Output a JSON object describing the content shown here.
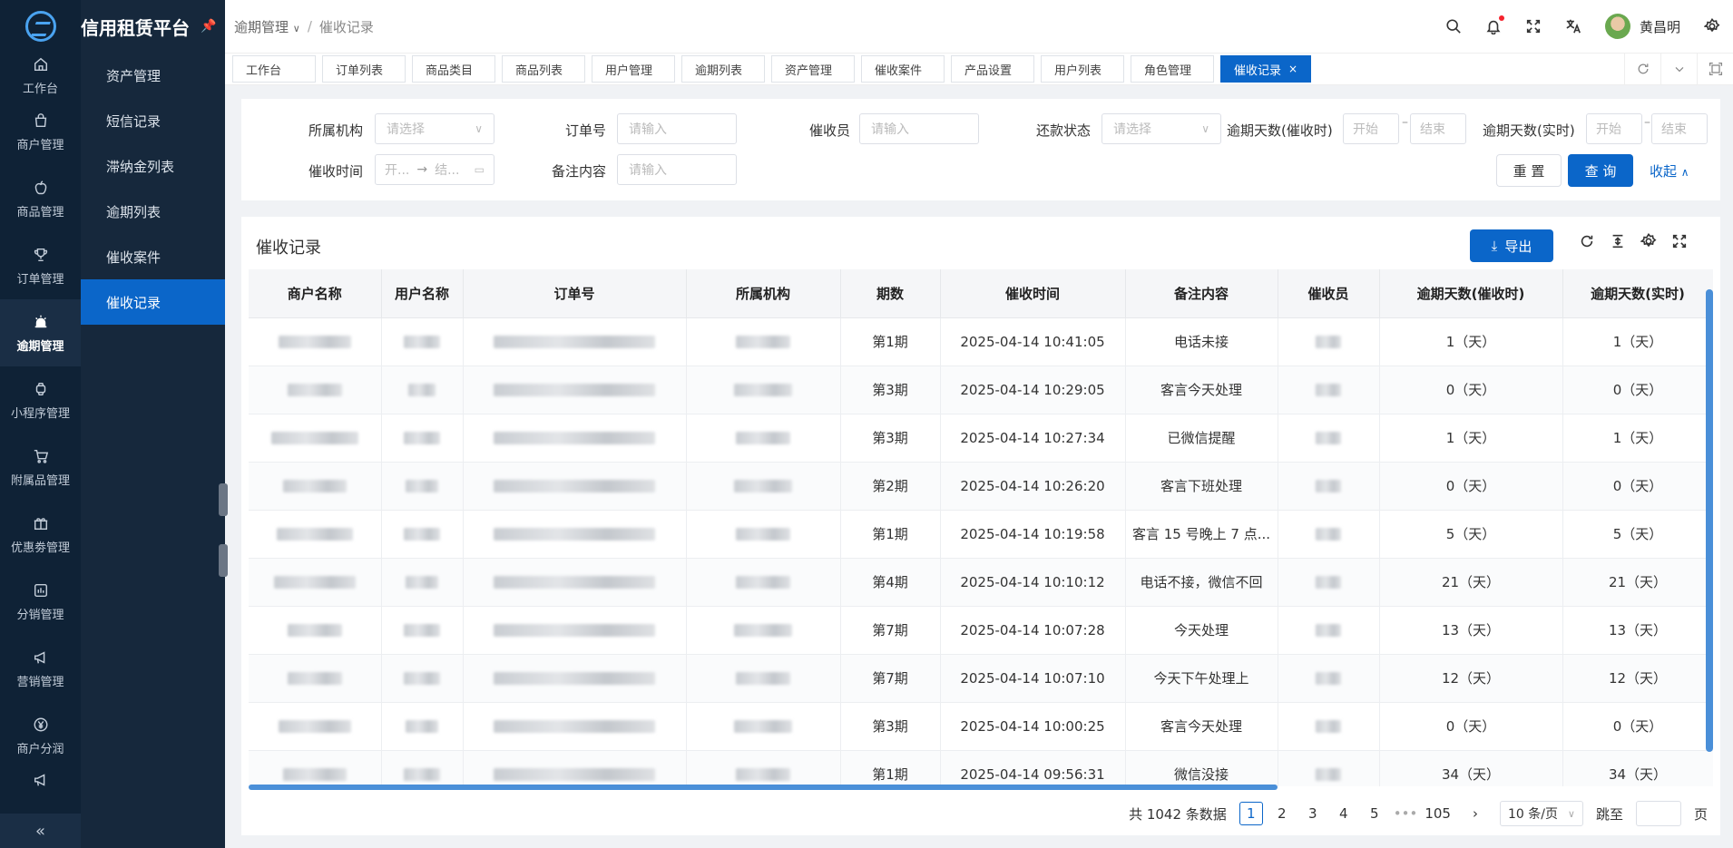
{
  "app": {
    "title": "信用租赁平台"
  },
  "rail": {
    "items": [
      {
        "label": "工作台",
        "icon": "home-icon"
      },
      {
        "label": "商户管理",
        "icon": "shop-icon"
      },
      {
        "label": "商品管理",
        "icon": "apple-icon"
      },
      {
        "label": "订单管理",
        "icon": "trophy-icon"
      },
      {
        "label": "逾期管理",
        "icon": "alarm-icon"
      },
      {
        "label": "小程序管理",
        "icon": "watch-icon"
      },
      {
        "label": "附属品管理",
        "icon": "cart-icon"
      },
      {
        "label": "优惠劵管理",
        "icon": "gift-icon"
      },
      {
        "label": "分销管理",
        "icon": "chart-icon"
      },
      {
        "label": "营销管理",
        "icon": "megaphone-icon"
      },
      {
        "label": "商户分润",
        "icon": "yen-icon"
      }
    ],
    "active_index": 4,
    "collapse_glyph": "«"
  },
  "submenu": {
    "items": [
      "资产管理",
      "短信记录",
      "滞纳金列表",
      "逾期列表",
      "催收案件",
      "催收记录"
    ],
    "active_index": 5
  },
  "breadcrumb": {
    "parent": "逾期管理",
    "separator": "/",
    "current": "催收记录"
  },
  "header": {
    "username": "黄昌明",
    "notification_dot_color": "#f5222d"
  },
  "tabs": {
    "items": [
      "工作台",
      "订单列表",
      "商品类目",
      "商品列表",
      "用户管理",
      "逾期列表",
      "资产管理",
      "催收案件",
      "产品设置",
      "用户列表",
      "角色管理",
      "催收记录"
    ],
    "active_index": 11,
    "close_glyph": "×"
  },
  "filter": {
    "org_label": "所属机构",
    "org_placeholder": "请选择",
    "order_label": "订单号",
    "order_placeholder": "请输入",
    "collector_label": "催收员",
    "collector_placeholder": "请输入",
    "repay_label": "还款状态",
    "repay_placeholder": "请选择",
    "overdue_collect_label": "逾期天数(催收时)",
    "start": "开始",
    "end": "结束",
    "overdue_real_label": "逾期天数(实时)",
    "time_label": "催收时间",
    "time_start": "开...",
    "time_end": "结...",
    "remark_label": "备注内容",
    "remark_placeholder": "请输入",
    "reset": "重 置",
    "query": "查 询",
    "collapse": "收起"
  },
  "table": {
    "title": "催收记录",
    "export": "导出",
    "columns": [
      "商户名称",
      "用户名称",
      "订单号",
      "所属机构",
      "期数",
      "催收时间",
      "备注内容",
      "催收员",
      "逾期天数(催收时)",
      "逾期天数(实时)"
    ],
    "rows": [
      {
        "period": "第1期",
        "time": "2025-04-14 10:41:05",
        "remark": "电话未接",
        "overdue_collect": "1（天）",
        "overdue_real": "1（天）"
      },
      {
        "period": "第3期",
        "time": "2025-04-14 10:29:05",
        "remark": "客言今天处理",
        "overdue_collect": "0（天）",
        "overdue_real": "0（天）"
      },
      {
        "period": "第3期",
        "time": "2025-04-14 10:27:34",
        "remark": "已微信提醒",
        "overdue_collect": "1（天）",
        "overdue_real": "1（天）"
      },
      {
        "period": "第2期",
        "time": "2025-04-14 10:26:20",
        "remark": "客言下班处理",
        "overdue_collect": "0（天）",
        "overdue_real": "0（天）"
      },
      {
        "period": "第1期",
        "time": "2025-04-14 10:19:58",
        "remark": "客言 15 号晚上 7 点...",
        "overdue_collect": "5（天）",
        "overdue_real": "5（天）"
      },
      {
        "period": "第4期",
        "time": "2025-04-14 10:10:12",
        "remark": "电话不接，微信不回",
        "overdue_collect": "21（天）",
        "overdue_real": "21（天）"
      },
      {
        "period": "第7期",
        "time": "2025-04-14 10:07:28",
        "remark": "今天处理",
        "overdue_collect": "13（天）",
        "overdue_real": "13（天）"
      },
      {
        "period": "第7期",
        "time": "2025-04-14 10:07:10",
        "remark": "今天下午处理上",
        "overdue_collect": "12（天）",
        "overdue_real": "12（天）"
      },
      {
        "period": "第3期",
        "time": "2025-04-14 10:00:25",
        "remark": "客言今天处理",
        "overdue_collect": "0（天）",
        "overdue_real": "0（天）"
      },
      {
        "period": "第1期",
        "time": "2025-04-14 09:56:31",
        "remark": "微信没接",
        "overdue_collect": "34（天）",
        "overdue_real": "34（天）"
      }
    ]
  },
  "pagination": {
    "total": "共 1042 条数据",
    "pages": [
      "1",
      "2",
      "3",
      "4",
      "5",
      "•••",
      "105"
    ],
    "active": "1",
    "page_size": "10 条/页",
    "jump_label": "跳至",
    "page_unit": "页"
  },
  "colors": {
    "primary": "#0b66c9",
    "rail_bg": "#0f2236",
    "submenu_bg": "#16283c"
  }
}
